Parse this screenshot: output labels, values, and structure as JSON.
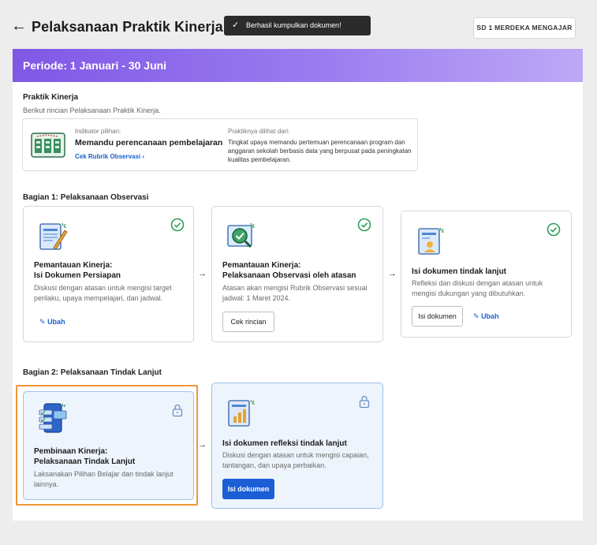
{
  "header": {
    "title": "Pelaksanaan Praktik Kinerja",
    "toast": "Berhasil kumpulkan dokumen!",
    "school": "SD 1 MERDEKA MENGAJAR"
  },
  "period": "Periode: 1 Januari - 30 Juni",
  "praktik": {
    "title": "Praktik Kinerja",
    "subtitle": "Berikut rincian Pelaksanaan Praktik Kinerja.",
    "indikator_label": "Indikator pilihan:",
    "indikator_value": "Memandu perencanaan pembelajaran",
    "rubrik_link": "Cek Rubrik Observasi  ›",
    "dilihat_label": "Praktiknya dilihat dari:",
    "dilihat_text": "Tingkat upaya memandu pertemuan perencanaan program dan anggaran sekolah berbasis data yang berpusat pada peningkatan kualitas pembelajaran."
  },
  "bagian1": {
    "title": "Bagian 1: Pelaksanaan Observasi",
    "steps": [
      {
        "title1": "Pemantauan Kinerja:",
        "title2": "Isi Dokumen Persiapan",
        "desc": "Diskusi dengan atasan untuk mengisi target perilaku, upaya mempelajari, dan jadwal.",
        "link": "Ubah",
        "status": "check-icon"
      },
      {
        "title1": "Pemantauan Kinerja:",
        "title2": "Pelaksanaan Observasi oleh atasan",
        "desc": "Atasan akan mengisi Rubrik Observasi sesuai jadwal: 1 Maret 2024.",
        "button": "Cek rincian",
        "status": "check-icon"
      },
      {
        "title": "Isi dokumen tindak lanjut",
        "desc": "Refleksi dan diskusi dengan atasan untuk mengisi dukungan yang dibutuhkan.",
        "button": "Isi dokumen",
        "link": "Ubah",
        "status": "check-icon"
      }
    ]
  },
  "bagian2": {
    "title": "Bagian 2: Pelaksanaan Tindak Lanjut",
    "steps": [
      {
        "title1": "Pembinaan Kinerja:",
        "title2": "Pelaksanaan Tindak Lanjut",
        "desc": "Laksanakan Pilihan Belajar dan tindak lanjut lainnya.",
        "status": "lock-icon"
      },
      {
        "title": "Isi dokumen refleksi tindak lanjut",
        "desc": "Diskusi dengan atasan untuk mengisi capaian, tantangan, dan upaya perbaikan.",
        "button": "Isi dokumen",
        "status": "lock-icon"
      }
    ]
  },
  "colors": {
    "primary": "#1b5ed6",
    "success": "#2e9d57",
    "highlight": "#ee9639",
    "period_gradient_start": "#7f58e6"
  }
}
